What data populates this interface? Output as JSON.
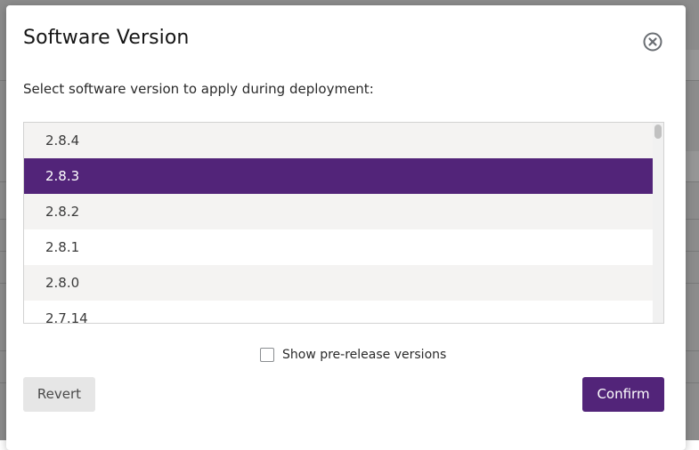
{
  "dialog": {
    "title": "Software Version",
    "instruction": "Select software version to apply during deployment:",
    "close_icon": "close-circle-icon"
  },
  "version_list": {
    "items": [
      {
        "label": "2.8.4",
        "selected": false
      },
      {
        "label": "2.8.3",
        "selected": true
      },
      {
        "label": "2.8.2",
        "selected": false
      },
      {
        "label": "2.8.1",
        "selected": false
      },
      {
        "label": "2.8.0",
        "selected": false
      },
      {
        "label": "2.7.14",
        "selected": false
      }
    ]
  },
  "prerelease": {
    "label": "Show pre-release versions",
    "checked": false
  },
  "buttons": {
    "revert_label": "Revert",
    "confirm_label": "Confirm"
  },
  "colors": {
    "accent": "#522479",
    "list_alt_row": "#f4f3f2",
    "backdrop": "#8c8c8c"
  }
}
